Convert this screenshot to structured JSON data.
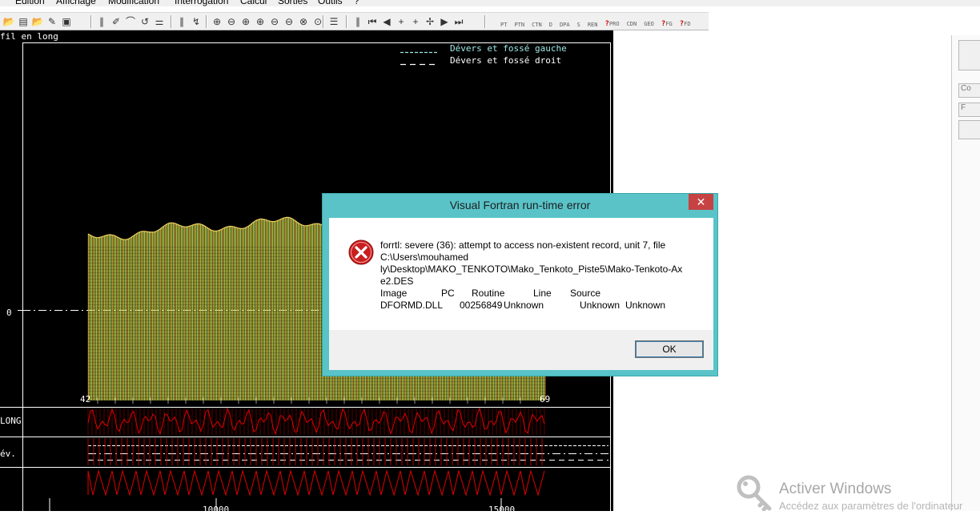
{
  "menu": [
    "Édition",
    "Affichage",
    "Modification",
    "Interrogation",
    "Calcul",
    "Sorties",
    "Outils",
    "?"
  ],
  "toolbar": {
    "codes": [
      "PT",
      "PTN",
      "CTN",
      "D",
      "DPA",
      "S",
      "REN"
    ],
    "q_codes": [
      {
        "mark": "?",
        "code": "PRO"
      },
      {
        "mark": "",
        "code": "CDN"
      },
      {
        "mark": "",
        "code": "GEO"
      },
      {
        "mark": "?",
        "code": "FG"
      },
      {
        "mark": "?",
        "code": "FD"
      }
    ]
  },
  "plot": {
    "title": "fil en long",
    "legend_left": "Dévers et fossé gauche",
    "legend_right": "Dévers et fossé droit",
    "legend_left_color": "#9fe8e8",
    "legend_right_color": "#ffffff",
    "zero_label": "0",
    "label_long": "LONG",
    "label_dev": "év.",
    "x_ticks": [
      "10000",
      "15000"
    ],
    "station_first": "42",
    "station_last": "69",
    "fill_colors": [
      "#e0b040",
      "#c8d840",
      "#b8e068"
    ],
    "curve_color": "#e00000"
  },
  "dialog": {
    "title": "Visual Fortran run-time error",
    "close_glyph": "✕",
    "message_lines": [
      "forrtl: severe (36): attempt to access non-existent record, unit 7, file",
      "C:\\Users\\mouhamed",
      "ly\\Desktop\\MAKO_TENKOTO\\Mako_Tenkoto_Piste5\\Mako-Tenkoto-Ax",
      "e2.DES"
    ],
    "table_headers": [
      "Image",
      "PC",
      "Routine",
      "Line",
      "Source"
    ],
    "table_values": [
      "DFORMD.DLL",
      "00256849",
      "Unknown",
      "Unknown",
      "Unknown"
    ],
    "ok_label": "OK"
  },
  "side_panel": {
    "labels": [
      "Co",
      "F"
    ]
  },
  "watermark": {
    "title": "Activer Windows",
    "subtitle": "Accédez aux paramètres de l'ordinateur"
  }
}
